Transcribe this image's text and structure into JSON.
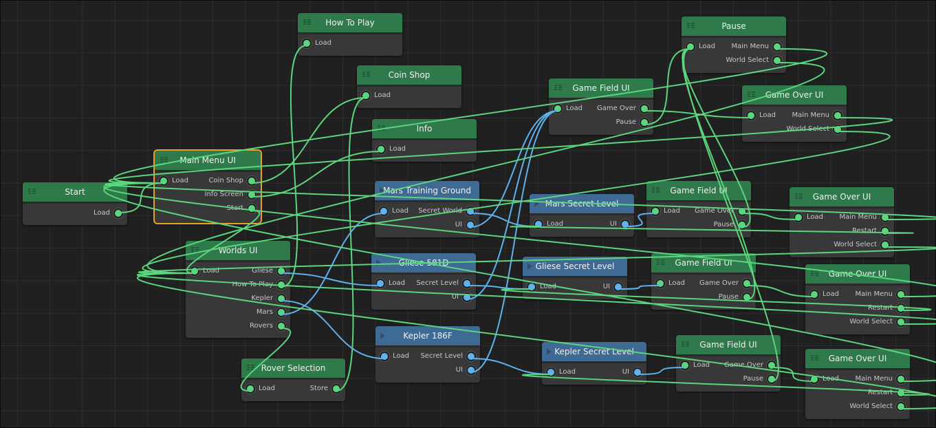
{
  "colors": {
    "background": "#202020",
    "grid": "#2e2e2e",
    "ui_node_header": "#2f7a4a",
    "level_node_header": "#3f6a93",
    "node_body": "#383838",
    "ui_wire": "#5cd67e",
    "level_wire": "#5fb2ee",
    "selection": "#e6a226"
  },
  "nodes": [
    {
      "id": "start",
      "title": "Start",
      "kind": "ui",
      "inputs": [],
      "outputs": [
        "Load"
      ]
    },
    {
      "id": "main-menu-ui",
      "title": "Main Menu UI",
      "kind": "ui",
      "selected": true,
      "inputs": [
        "Load"
      ],
      "outputs": [
        "Coin Shop",
        "Info Screen",
        "Start"
      ]
    },
    {
      "id": "worlds-ui",
      "title": "Worlds UI",
      "kind": "ui",
      "inputs": [
        "Load"
      ],
      "outputs": [
        "Gliese",
        "How To Play",
        "Kepler",
        "Mars",
        "Rovers"
      ]
    },
    {
      "id": "rover-selection",
      "title": "Rover Selection",
      "kind": "ui",
      "inputs": [
        "Load"
      ],
      "outputs": [
        "Store"
      ]
    },
    {
      "id": "how-to-play",
      "title": "How To Play",
      "kind": "ui",
      "inputs": [
        "Load"
      ],
      "outputs": []
    },
    {
      "id": "coin-shop",
      "title": "Coin Shop",
      "kind": "ui",
      "inputs": [
        "Load"
      ],
      "outputs": []
    },
    {
      "id": "info",
      "title": "Info",
      "kind": "ui",
      "inputs": [
        "Load"
      ],
      "outputs": []
    },
    {
      "id": "mars-training-ground",
      "title": "Mars  Training Ground",
      "kind": "level",
      "inputs": [
        "Load"
      ],
      "outputs": [
        "Secret World",
        "UI"
      ]
    },
    {
      "id": "gliese-581d",
      "title": "Gliese  581D",
      "kind": "level",
      "inputs": [
        "Load"
      ],
      "outputs": [
        "Secret Level",
        "UI"
      ]
    },
    {
      "id": "kepler-186f",
      "title": "Kepler  186F",
      "kind": "level",
      "inputs": [
        "Load"
      ],
      "outputs": [
        "Secret Level",
        "UI"
      ]
    },
    {
      "id": "mars-secret-level",
      "title": "Mars  Secret Level",
      "kind": "level",
      "inputs": [
        "Load"
      ],
      "outputs": [
        "UI"
      ]
    },
    {
      "id": "gliese-secret-level",
      "title": "Gliese Secret Level",
      "kind": "level",
      "inputs": [
        "Load"
      ],
      "outputs": [
        "UI"
      ]
    },
    {
      "id": "kepler-secret-level",
      "title": "Kepler  Secret Level",
      "kind": "level",
      "inputs": [
        "Load"
      ],
      "outputs": [
        "UI"
      ]
    },
    {
      "id": "game-field-ui-1",
      "title": "Game Field UI",
      "kind": "ui",
      "inputs": [
        "Load"
      ],
      "outputs": [
        "Game Over",
        "Pause"
      ]
    },
    {
      "id": "game-field-ui-2",
      "title": "Game Field UI",
      "kind": "ui",
      "inputs": [
        "Load"
      ],
      "outputs": [
        "Game Over",
        "Pause"
      ]
    },
    {
      "id": "game-field-ui-3",
      "title": "Game Field UI",
      "kind": "ui",
      "inputs": [
        "Load"
      ],
      "outputs": [
        "Game Over",
        "Pause"
      ]
    },
    {
      "id": "game-field-ui-4",
      "title": "Game Field UI",
      "kind": "ui",
      "inputs": [
        "Load"
      ],
      "outputs": [
        "Game Over",
        "Pause"
      ]
    },
    {
      "id": "pause",
      "title": "Pause",
      "kind": "ui",
      "inputs": [
        "Load"
      ],
      "outputs": [
        "Main Menu",
        "World Select"
      ]
    },
    {
      "id": "game-over-ui-1",
      "title": "Game Over UI",
      "kind": "ui",
      "inputs": [
        "Load"
      ],
      "outputs": [
        "Main Menu",
        "World Select"
      ]
    },
    {
      "id": "game-over-ui-2",
      "title": "Game Over UI",
      "kind": "ui",
      "inputs": [
        "Load"
      ],
      "outputs": [
        "Main Menu",
        "Restart",
        "World Select"
      ]
    },
    {
      "id": "game-over-ui-3",
      "title": "Game Over UI",
      "kind": "ui",
      "inputs": [
        "Load"
      ],
      "outputs": [
        "Main Menu",
        "Restart",
        "World Select"
      ]
    },
    {
      "id": "game-over-ui-4",
      "title": "Game Over UI",
      "kind": "ui",
      "inputs": [
        "Load"
      ],
      "outputs": [
        "Main Menu",
        "Restart",
        "World Select"
      ]
    }
  ],
  "connections": [
    {
      "from": "start.Load",
      "to": "main-menu-ui.Load",
      "kind": "ui"
    },
    {
      "from": "main-menu-ui.Coin Shop",
      "to": "coin-shop.Load",
      "kind": "ui"
    },
    {
      "from": "main-menu-ui.Info Screen",
      "to": "info.Load",
      "kind": "ui"
    },
    {
      "from": "main-menu-ui.Start",
      "to": "worlds-ui.Load",
      "kind": "ui"
    },
    {
      "from": "worlds-ui.How To Play",
      "to": "how-to-play.Load",
      "kind": "ui"
    },
    {
      "from": "worlds-ui.Rovers",
      "to": "rover-selection.Load",
      "kind": "ui"
    },
    {
      "from": "rover-selection.Store",
      "to": "coin-shop.Load",
      "kind": "ui"
    },
    {
      "from": "worlds-ui.Mars",
      "to": "mars-training-ground.Load",
      "kind": "level"
    },
    {
      "from": "worlds-ui.Gliese",
      "to": "gliese-581d.Load",
      "kind": "level"
    },
    {
      "from": "worlds-ui.Kepler",
      "to": "kepler-186f.Load",
      "kind": "level"
    },
    {
      "from": "mars-training-ground.Secret World",
      "to": "mars-secret-level.Load",
      "kind": "level"
    },
    {
      "from": "gliese-581d.Secret Level",
      "to": "gliese-secret-level.Load",
      "kind": "level"
    },
    {
      "from": "kepler-186f.Secret Level",
      "to": "kepler-secret-level.Load",
      "kind": "level"
    },
    {
      "from": "mars-training-ground.UI",
      "to": "game-field-ui-1.Load",
      "kind": "level"
    },
    {
      "from": "gliese-581d.UI",
      "to": "game-field-ui-1.Load",
      "kind": "level"
    },
    {
      "from": "kepler-186f.UI",
      "to": "game-field-ui-1.Load",
      "kind": "level"
    },
    {
      "from": "mars-secret-level.UI",
      "to": "game-field-ui-2.Load",
      "kind": "level"
    },
    {
      "from": "gliese-secret-level.UI",
      "to": "game-field-ui-3.Load",
      "kind": "level"
    },
    {
      "from": "kepler-secret-level.UI",
      "to": "game-field-ui-4.Load",
      "kind": "level"
    },
    {
      "from": "game-field-ui-1.Game Over",
      "to": "game-over-ui-1.Load",
      "kind": "ui"
    },
    {
      "from": "game-field-ui-1.Pause",
      "to": "pause.Load",
      "kind": "ui"
    },
    {
      "from": "game-field-ui-2.Game Over",
      "to": "game-over-ui-2.Load",
      "kind": "ui"
    },
    {
      "from": "game-field-ui-2.Pause",
      "to": "pause.Load",
      "kind": "ui"
    },
    {
      "from": "game-field-ui-3.Game Over",
      "to": "game-over-ui-3.Load",
      "kind": "ui"
    },
    {
      "from": "game-field-ui-3.Pause",
      "to": "pause.Load",
      "kind": "ui"
    },
    {
      "from": "game-field-ui-4.Game Over",
      "to": "game-over-ui-4.Load",
      "kind": "ui"
    },
    {
      "from": "game-field-ui-4.Pause",
      "to": "pause.Load",
      "kind": "ui"
    },
    {
      "from": "pause.Main Menu",
      "to": "main-menu-ui.Load",
      "kind": "ui"
    },
    {
      "from": "pause.World Select",
      "to": "worlds-ui.Load",
      "kind": "ui"
    },
    {
      "from": "game-over-ui-1.Main Menu",
      "to": "main-menu-ui.Load",
      "kind": "ui"
    },
    {
      "from": "game-over-ui-1.World Select",
      "to": "worlds-ui.Load",
      "kind": "ui"
    },
    {
      "from": "game-over-ui-2.Main Menu",
      "to": "main-menu-ui.Load",
      "kind": "ui"
    },
    {
      "from": "game-over-ui-2.Restart",
      "to": "mars-secret-level.Load",
      "kind": "ui"
    },
    {
      "from": "game-over-ui-2.World Select",
      "to": "worlds-ui.Load",
      "kind": "ui"
    },
    {
      "from": "game-over-ui-3.Main Menu",
      "to": "main-menu-ui.Load",
      "kind": "ui"
    },
    {
      "from": "game-over-ui-3.Restart",
      "to": "gliese-secret-level.Load",
      "kind": "ui"
    },
    {
      "from": "game-over-ui-3.World Select",
      "to": "worlds-ui.Load",
      "kind": "ui"
    },
    {
      "from": "game-over-ui-4.Main Menu",
      "to": "main-menu-ui.Load",
      "kind": "ui"
    },
    {
      "from": "game-over-ui-4.Restart",
      "to": "kepler-secret-level.Load",
      "kind": "ui"
    },
    {
      "from": "game-over-ui-4.World Select",
      "to": "worlds-ui.Load",
      "kind": "ui"
    }
  ]
}
